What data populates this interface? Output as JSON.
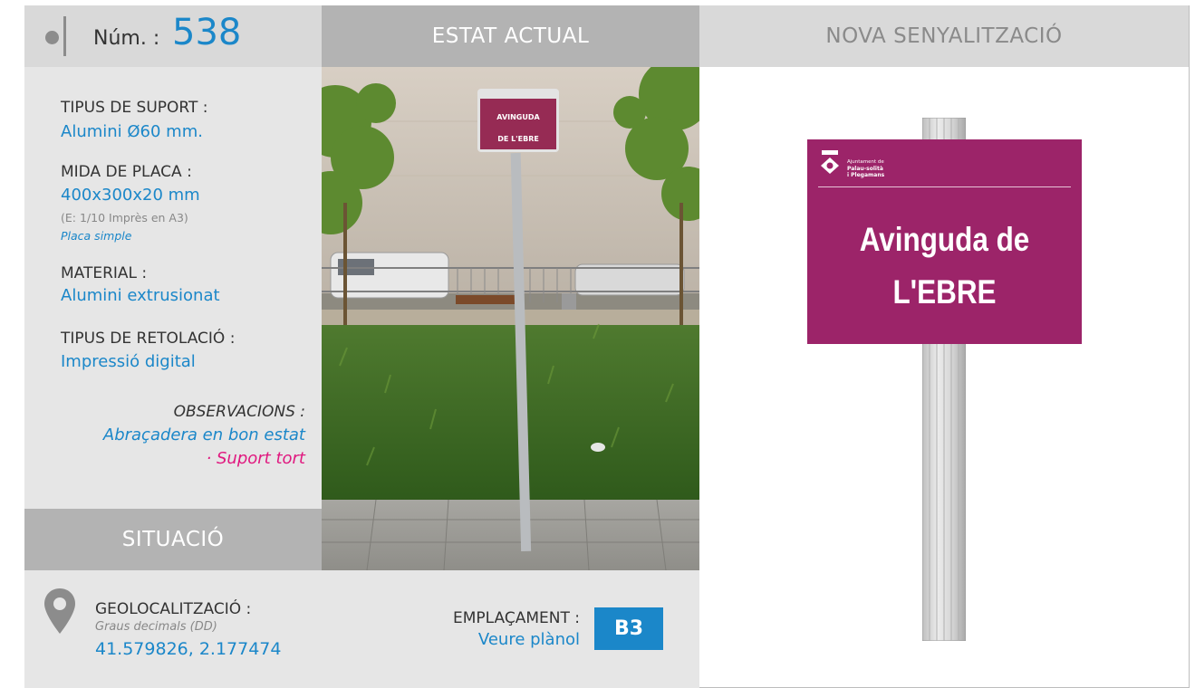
{
  "header": {
    "num_label": "Núm. :",
    "num_value": "538",
    "current_state": "ESTAT ACTUAL",
    "new_signage": "NOVA SENYALITZACIÓ"
  },
  "specs": {
    "support_label": "TIPUS DE SUPORT :",
    "support_value": "Alumini Ø60 mm.",
    "plate_label": "MIDA DE PLACA :",
    "plate_value": "400x300x20 mm",
    "plate_scale": "(E: 1/10 Imprès en A3)",
    "plate_type": "Placa simple",
    "material_label": "MATERIAL :",
    "material_value": "Alumini extrusionat",
    "lettering_label": "TIPUS DE RETOLACIÓ :",
    "lettering_value": "Impressió digital",
    "observations_label": "OBSERVACIONS :",
    "observations_ok": "Abraçadera en bon estat",
    "observations_issue": "· Suport tort"
  },
  "situation": {
    "title": "SITUACIÓ",
    "geo_label": "GEOLOCALITZACIÓ :",
    "geo_format": "Graus decimals (DD)",
    "geo_value": "41.579826, 2.177474",
    "location_label": "EMPLAÇAMENT :",
    "location_link": "Veure plànol",
    "location_code": "B3"
  },
  "photo": {
    "sign_line1": "AVINGUDA",
    "sign_line2": "DE L'EBRE"
  },
  "new_sign": {
    "org_line1": "Ajuntament de",
    "org_line2": "Palau-solità",
    "org_line3": "i Plegamans",
    "line1": "Avinguda de",
    "line2": "L'EBRE"
  },
  "colors": {
    "accent_blue": "#1b87c9",
    "sign_magenta": "#9c2469",
    "issue_pink": "#e0187f"
  }
}
